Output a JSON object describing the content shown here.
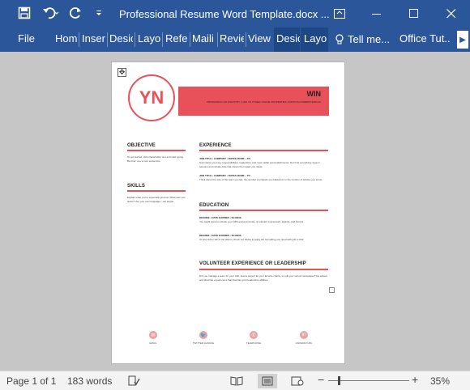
{
  "titlebar": {
    "document_title": "Professional Resume Word Template.docx ...",
    "save_icon": "save-icon",
    "undo_icon": "undo-icon",
    "redo_icon": "redo-icon",
    "customize_icon": "customize-qat-icon"
  },
  "ribbon": {
    "tabs": [
      {
        "label": "File"
      },
      {
        "label": "Hom"
      },
      {
        "label": "Inser"
      },
      {
        "label": "Desic"
      },
      {
        "label": "Layo"
      },
      {
        "label": "Refer"
      },
      {
        "label": "Maili"
      },
      {
        "label": "Revie"
      },
      {
        "label": "View"
      },
      {
        "label": "Desic"
      },
      {
        "label": "Layo"
      }
    ],
    "tell_me": "Tell me...",
    "office_tutorials": "Office Tut..."
  },
  "resume": {
    "initials": "YN",
    "name": "WIN",
    "tagline": "PROFESSION OR INDUSTRY | LINK TO OTHER ONLINE PROPERTIES: PORTFOLIO/WEBSITE/BLOG",
    "objective_title": "OBJECTIVE",
    "objective_text": "To get started, click placeholder text and start typing. Be brief: one or two sentences.",
    "skills_title": "SKILLS",
    "skills_text": "Explain what you're especially good at. What sets you apart? Use your own language—not jargon.",
    "experience_title": "EXPERIENCE",
    "job1_title": "JOB TITLE • COMPANY • DATES FROM – TO",
    "job1_text": "Summarize your key responsibilities, leadership, and most stellar accomplishments. Don't list everything; keep it relevant and include data that shows the impact you made.",
    "job2_title": "JOB TITLE • COMPANY • DATES FROM – TO",
    "job2_text": "Think about the size of the team you led, the number of projects you balanced, or the number of articles you wrote.",
    "education_title": "EDUCATION",
    "edu1_title": "DEGREE • DATE EARNED • SCHOOL",
    "edu1_text": "You might want to include your GPA and a summary of relevant coursework, awards, and honors.",
    "edu2_title": "DEGREE • DATE EARNED • SCHOOL",
    "edu2_text": "On the Home tab of the ribbon, check out Styles to apply the formatting you need with just a click.",
    "volunteer_title": "VOLUNTEER EXPERIENCE OR LEADERSHIP",
    "volunteer_text": "Did you manage a team for your club, lead a project for your favorite charity, or edit your school newspaper? Go ahead and describe experiences that illustrate your leadership abilities.",
    "contacts": [
      {
        "label": "EMAIL",
        "icon": "email-icon",
        "glyph": "✉"
      },
      {
        "label": "TWITTER HANDLE",
        "icon": "twitter-icon",
        "glyph": "🐦"
      },
      {
        "label": "TELEPHONE",
        "icon": "telephone-icon",
        "glyph": "✆"
      },
      {
        "label": "LINKEDIN URL",
        "icon": "linkedin-icon",
        "glyph": "in"
      }
    ]
  },
  "statusbar": {
    "page": "Page 1 of 1",
    "words": "183 words",
    "zoom": "35%",
    "zoom_minus": "−",
    "zoom_plus": "+"
  },
  "colors": {
    "accent": "#e9515a",
    "title_bar": "#2b579a"
  }
}
